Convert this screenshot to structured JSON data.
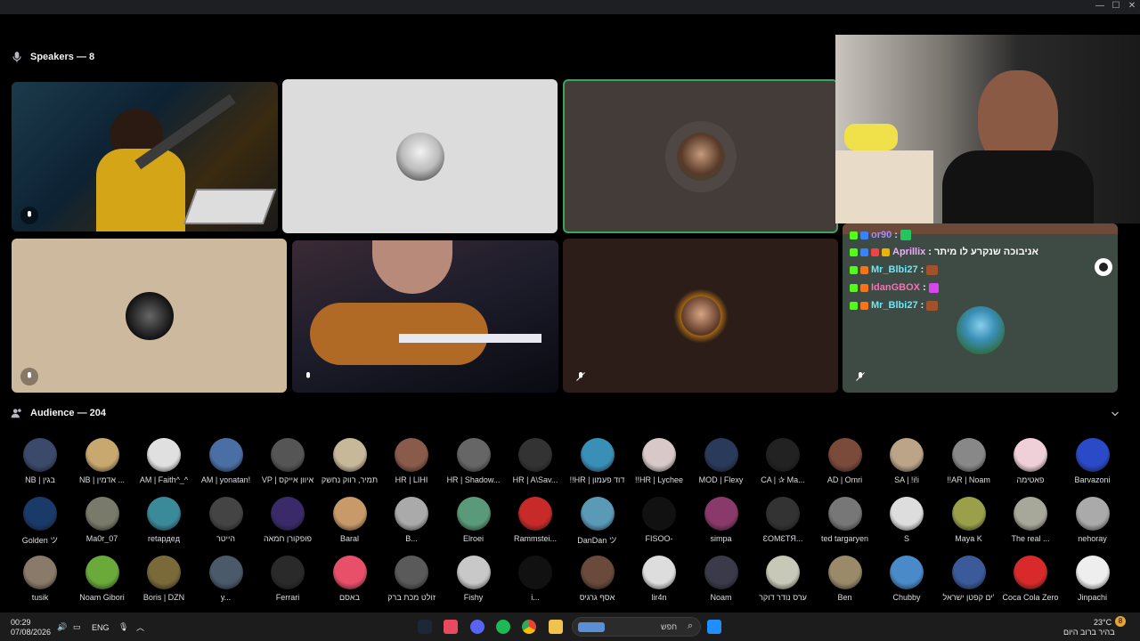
{
  "speakers_header": "Speakers — 8",
  "audience_header": "Audience — 204",
  "chat": [
    {
      "user": "or90",
      "msg": "",
      "color": "#a78bfa"
    },
    {
      "user": "Aprillix",
      "msg": "אניבוכה שנקרע לו מיתר",
      "color": "#f0abfc"
    },
    {
      "user": "Mr_Blbi27",
      "msg": "",
      "color": "#67e8f9"
    },
    {
      "user": "IdanGBOX",
      "msg": "",
      "color": "#f472b6"
    },
    {
      "user": "Mr_Blbi27",
      "msg": "",
      "color": "#67e8f9"
    }
  ],
  "audience": [
    [
      "NB | בגין",
      "NB | אדמין ...",
      "AM | Faith^_^",
      "AM | yonatan!",
      "VP | איוון אייקס",
      "תמיר, רווק נחשק",
      "HR | LIHI",
      "HR | Shadow...",
      "HR | A\\Sav...",
      "!!HR | דוד פעמון",
      "!!HR | Lychee",
      "MOD | Flexy",
      "CA | ✰ Ma...",
      "AD | Omri",
      "SA | !i!i",
      "!!AR | Noam",
      "פאטימה",
      "Barvazoni"
    ],
    [
      "Golden ツ",
      "Ma0r_07",
      "retapдeд",
      "הייטר",
      "פופקורן חמאה",
      "Baral",
      "B...",
      "Elroei",
      "Rammstei...",
      "DanDan ツ",
      "FISOO-",
      "simpa",
      "ƐOMƐTЯ...",
      "ted targaryen",
      "S",
      "Maya K",
      "The real ...",
      "nehoray"
    ],
    [
      "tusik",
      "Noam Gibori",
      "Boris | DZN",
      "y...",
      "Ferrari",
      "באסם",
      "זולט מכת ברק",
      "Fishy",
      "i...",
      "אסף גרגיס",
      "lir4n",
      "Noam",
      "ערס נודר דוקר",
      "Ben",
      "Chubby",
      "ים קפטן ישראל'",
      "Coca Cola Zero",
      "Jinpachi"
    ]
  ],
  "taskbar": {
    "time": "00:29",
    "date": "07/08/2026",
    "lang": "ENG",
    "search": "חפש",
    "weather_temp": "23°C",
    "weather_desc": "בהיר ברוב היום",
    "notif_count": "8"
  }
}
